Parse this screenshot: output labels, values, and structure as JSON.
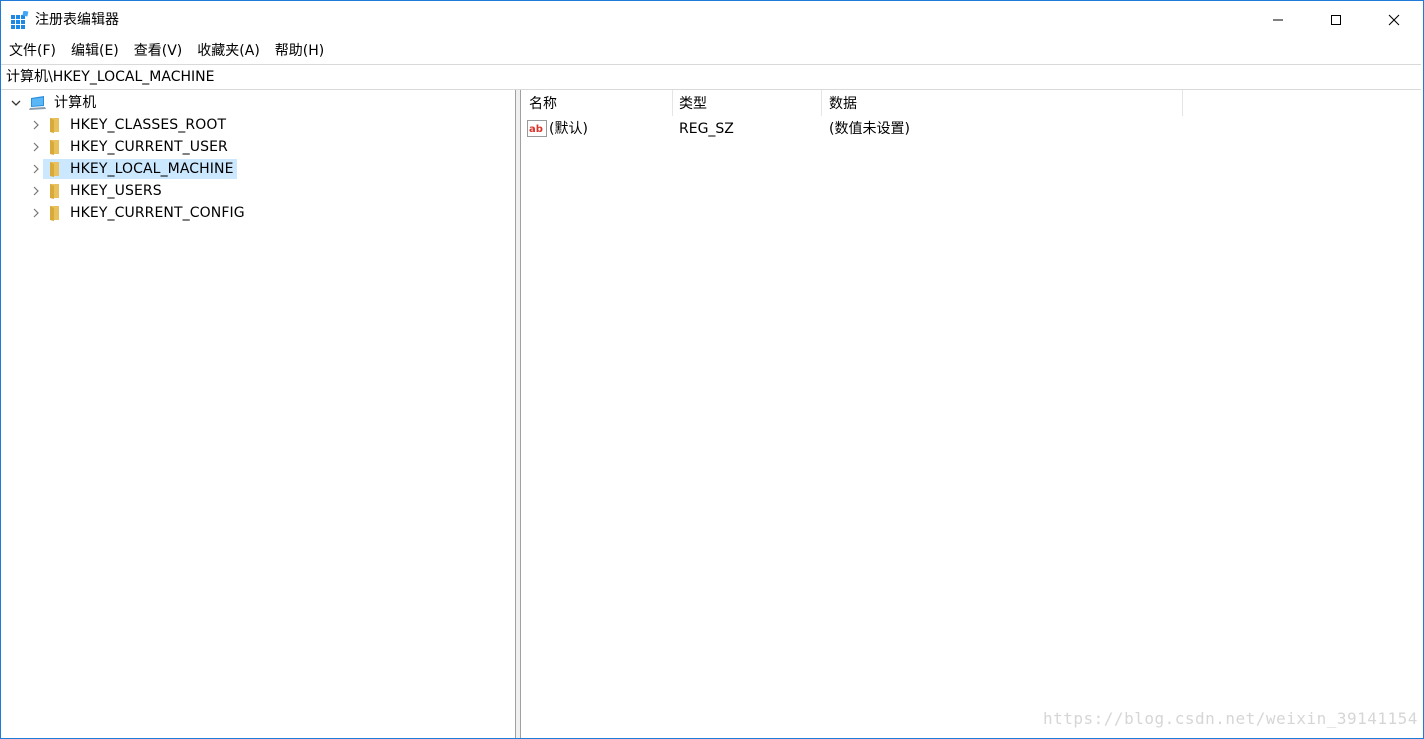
{
  "window": {
    "title": "注册表编辑器",
    "icon": "regedit-icon",
    "controls": [
      "minimize-icon",
      "maximize-icon",
      "close-icon"
    ]
  },
  "menu": {
    "items": [
      {
        "label": "文件(F)"
      },
      {
        "label": "编辑(E)"
      },
      {
        "label": "查看(V)"
      },
      {
        "label": "收藏夹(A)"
      },
      {
        "label": "帮助(H)"
      }
    ]
  },
  "address": {
    "value": "计算机\\HKEY_LOCAL_MACHINE"
  },
  "tree": {
    "root": {
      "label": "计算机",
      "expanded": true
    },
    "nodes": [
      {
        "label": "HKEY_CLASSES_ROOT",
        "selected": false
      },
      {
        "label": "HKEY_CURRENT_USER",
        "selected": false
      },
      {
        "label": "HKEY_LOCAL_MACHINE",
        "selected": true
      },
      {
        "label": "HKEY_USERS",
        "selected": false
      },
      {
        "label": "HKEY_CURRENT_CONFIG",
        "selected": false
      }
    ]
  },
  "list": {
    "columns": [
      "名称",
      "类型",
      "数据"
    ],
    "rows": [
      {
        "name": "(默认)",
        "type": "REG_SZ",
        "data": "(数值未设置)",
        "icon": "string-value-icon"
      }
    ]
  },
  "watermark": "https://blog.csdn.net/weixin_39141154",
  "colors": {
    "selection": "#cce8ff",
    "window_border": "#1f7ad8",
    "folder": "#e8c15d"
  }
}
